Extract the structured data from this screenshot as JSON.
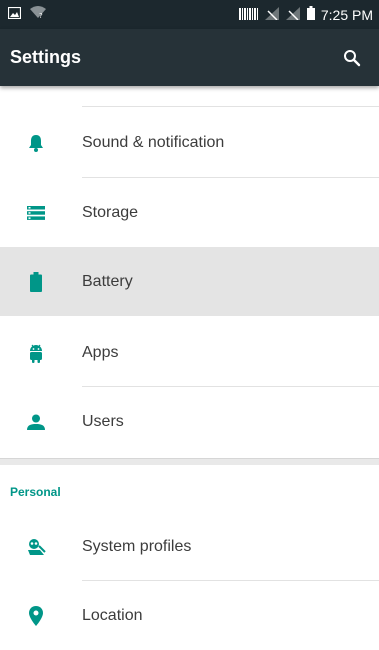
{
  "status_bar": {
    "time": "7:25 PM"
  },
  "toolbar": {
    "title": "Settings"
  },
  "device_items": [
    {
      "label": "Sound & notification",
      "icon": "bell-icon"
    },
    {
      "label": "Storage",
      "icon": "storage-icon"
    },
    {
      "label": "Battery",
      "icon": "battery-icon"
    },
    {
      "label": "Apps",
      "icon": "android-icon"
    },
    {
      "label": "Users",
      "icon": "person-icon"
    }
  ],
  "personal": {
    "header": "Personal",
    "items": [
      {
        "label": "System profiles",
        "icon": "system-profiles-icon"
      },
      {
        "label": "Location",
        "icon": "location-pin-icon"
      }
    ]
  },
  "colors": {
    "accent": "#009688",
    "toolbar": "#263238",
    "status_bar": "#1c282e",
    "highlight": "#e4e4e4"
  }
}
